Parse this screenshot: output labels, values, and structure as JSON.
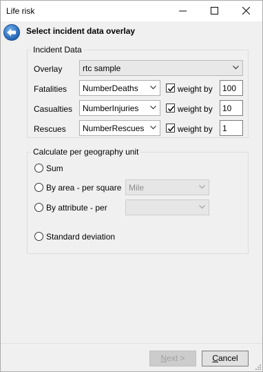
{
  "window": {
    "title": "Life risk"
  },
  "header": {
    "title": "Select incident data overlay",
    "back_icon": "back-arrow-icon"
  },
  "incident_data": {
    "group_label": "Incident Data",
    "overlay": {
      "label": "Overlay",
      "value": "rtc sample"
    },
    "rows": [
      {
        "label": "Fatalities",
        "field": "NumberDeaths",
        "weight_label": "weight by",
        "weight_checked": true,
        "weight": "100"
      },
      {
        "label": "Casualties",
        "field": "NumberInjuries",
        "weight_label": "weight by",
        "weight_checked": true,
        "weight": "10"
      },
      {
        "label": "Rescues",
        "field": "NumberRescues",
        "weight_label": "weight by",
        "weight_checked": true,
        "weight": "1"
      }
    ]
  },
  "calc": {
    "group_label": "Calculate per geography unit",
    "options": [
      {
        "label": "Sum",
        "selected": false
      },
      {
        "label": "By area - per square",
        "selected": false,
        "unit": "Mile"
      },
      {
        "label": "By attribute - per",
        "selected": false,
        "attribute": ""
      },
      {
        "label": "Standard deviation",
        "selected": false
      }
    ]
  },
  "footer": {
    "next_label": "Next >",
    "next_mnemonic": "N",
    "next_rest": "ext >",
    "cancel_label": "Cancel",
    "cancel_mnemonic": "C",
    "cancel_rest": "ancel"
  },
  "colors": {
    "accent": "#1f6fc5",
    "background": "#f0f0f0"
  }
}
